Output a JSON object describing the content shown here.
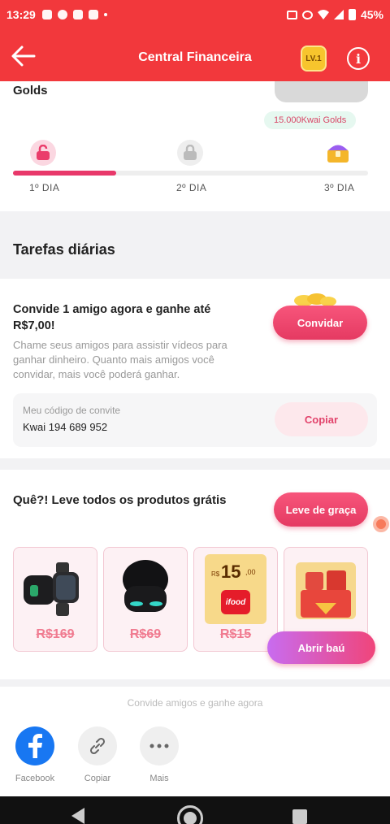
{
  "status": {
    "time": "13:29",
    "battery": "45%"
  },
  "header": {
    "title": "Central Financeira",
    "level": "LV.1"
  },
  "golds_card": {
    "cut_text": "Golds",
    "reward_tag": "15.000Kwai Golds",
    "progress": 0.29,
    "days": [
      "1º DIA",
      "2º DIA",
      "3º DIA"
    ]
  },
  "daily": {
    "title": "Tarefas diárias",
    "invite_title": "Convide 1 amigo agora e ganhe até R$7,00!",
    "invite_desc": "Chame seus amigos para assistir vídeos para ganhar dinheiro. Quanto mais amigos você convidar, mais você poderá ganhar.",
    "invite_button": "Convidar",
    "code_label": "Meu código de convite",
    "code_value": "Kwai 194 689 952",
    "copy_button": "Copiar"
  },
  "products": {
    "title": "Quê?! Leve todos os produtos grátis",
    "button": "Leve de graça",
    "items": [
      {
        "price": "R$169"
      },
      {
        "price": "R$69"
      },
      {
        "price": "R$15",
        "voucher_currency": "R$",
        "voucher_value": "15",
        "voucher_cents": ",00",
        "voucher_brand": "ifood"
      },
      {
        "price": ""
      }
    ],
    "chest_button": "Abrir baú"
  },
  "share": {
    "hint": "Convide amigos e ganhe agora",
    "options": [
      "Facebook",
      "Copiar",
      "Mais"
    ]
  },
  "colors": {
    "primary": "#f2383c",
    "accent": "#e53a62"
  }
}
